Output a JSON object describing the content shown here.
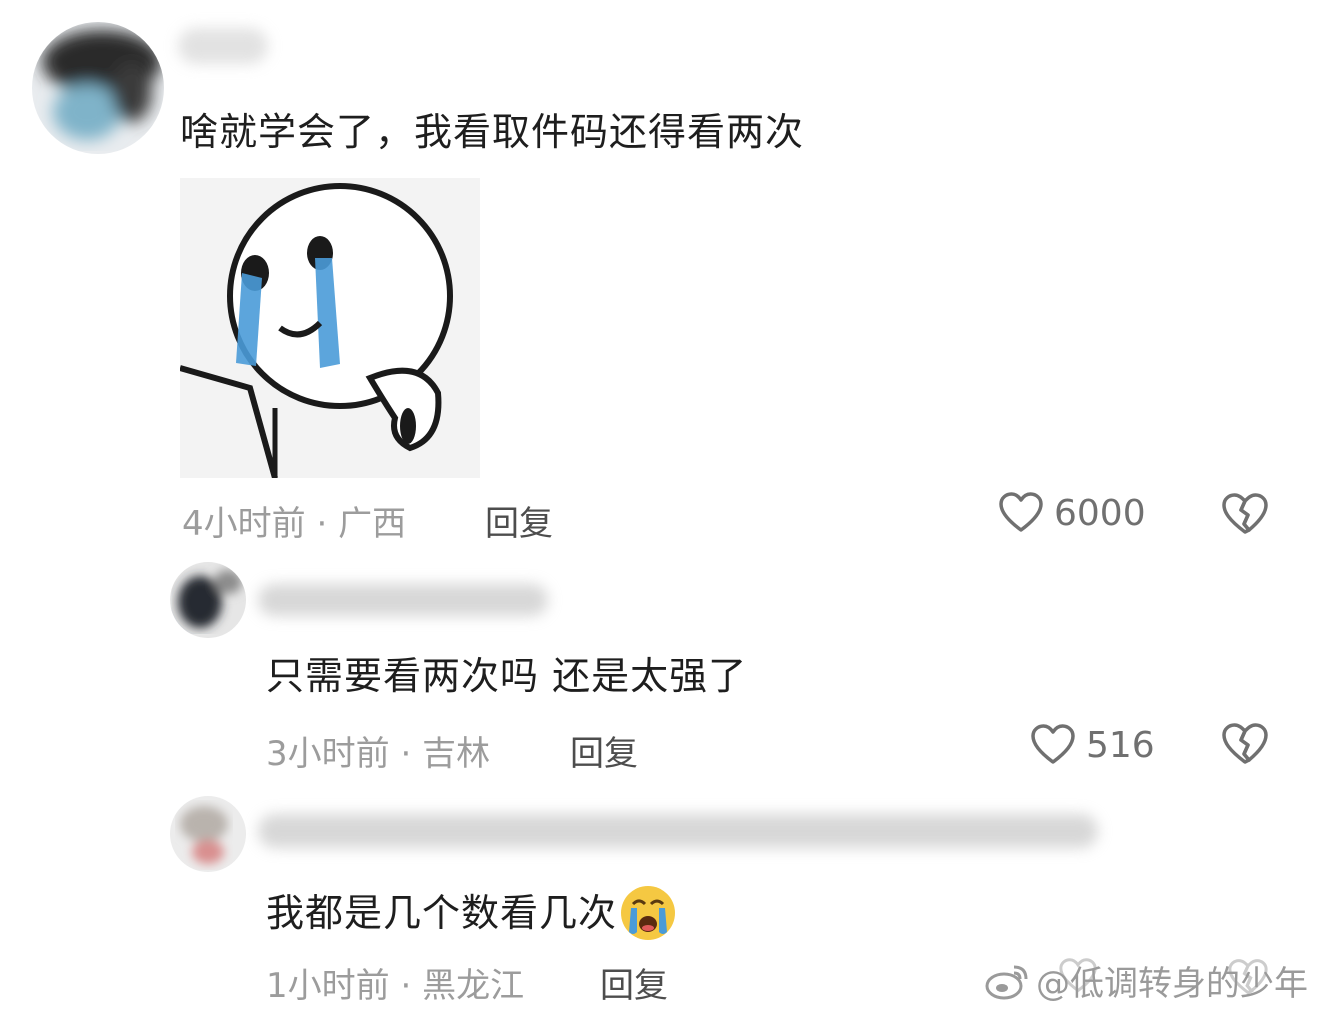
{
  "comments": [
    {
      "text": "啥就学会了，我看取件码还得看两次",
      "time": "4小时前",
      "separator": "·",
      "location": "广西",
      "reply_label": "回复",
      "likes": "6000"
    },
    {
      "text": "只需要看两次吗 还是太强了",
      "time": "3小时前",
      "separator": "·",
      "location": "吉林",
      "reply_label": "回复",
      "likes": "516"
    },
    {
      "text": "我都是几个数看几次",
      "emoji": "😭",
      "time": "1小时前",
      "separator": "·",
      "location": "黑龙江",
      "reply_label": "回复"
    }
  ],
  "watermark": {
    "text": "@低调转身的少年",
    "icon": "weibo-logo-icon"
  },
  "colors": {
    "meta": "#9c9c9c",
    "reply": "#4d4d4d",
    "tear": "#4a9bd8",
    "emoji": "#f5c842"
  }
}
